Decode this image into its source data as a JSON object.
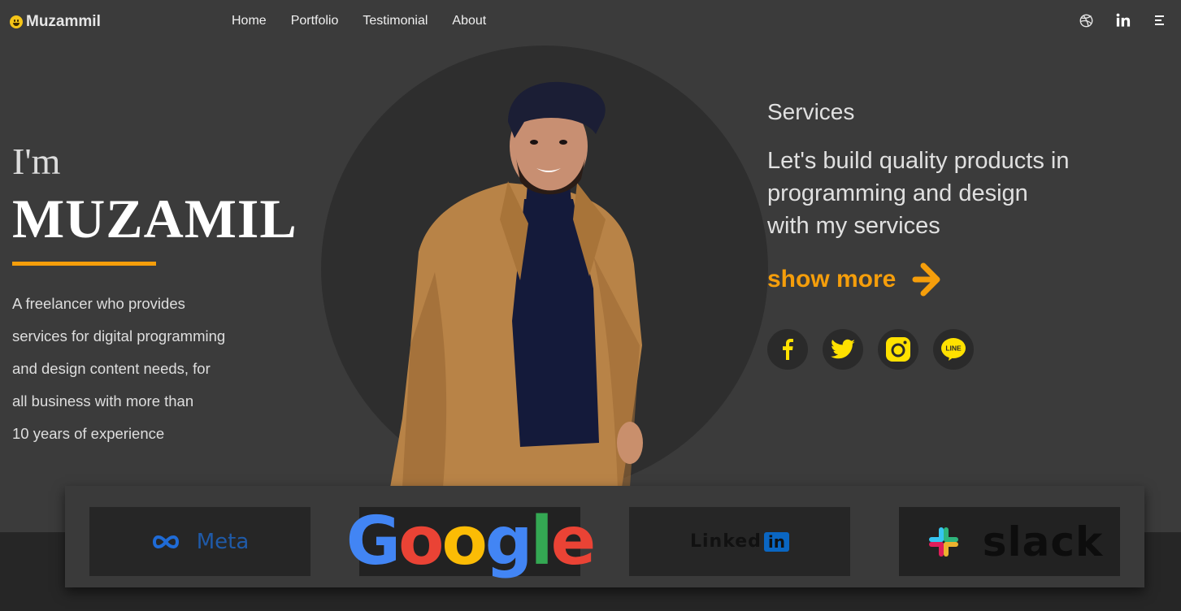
{
  "nav": {
    "brand": "Muzammil",
    "links": [
      "Home",
      "Portfolio",
      "Testimonial",
      "About"
    ],
    "icons": [
      "dribbble-icon",
      "linkedin-icon",
      "menu-icon"
    ]
  },
  "hero": {
    "greeting": "I'm",
    "name": "MUZAMIL",
    "intro_lines": [
      "A freelancer who provides",
      "services for digital programming",
      "and design content needs, for",
      "all business with more than",
      "10 years of experience"
    ]
  },
  "services": {
    "title": "Services",
    "text_lines": [
      "Let's build quality products in",
      "programming and design",
      "with my services"
    ],
    "show_more": "show more"
  },
  "social": [
    "facebook-icon",
    "twitter-icon",
    "instagram-icon",
    "line-icon"
  ],
  "partners": {
    "meta": "Meta",
    "google": [
      "G",
      "o",
      "o",
      "g",
      "l",
      "e"
    ],
    "linkedin_word": "Linked",
    "linkedin_in": "in",
    "slack": "slack"
  },
  "colors": {
    "accent": "#f59e0b",
    "background": "#3b3b3b",
    "circle": "#2e2e2e",
    "social_icon": "#ffe100"
  }
}
